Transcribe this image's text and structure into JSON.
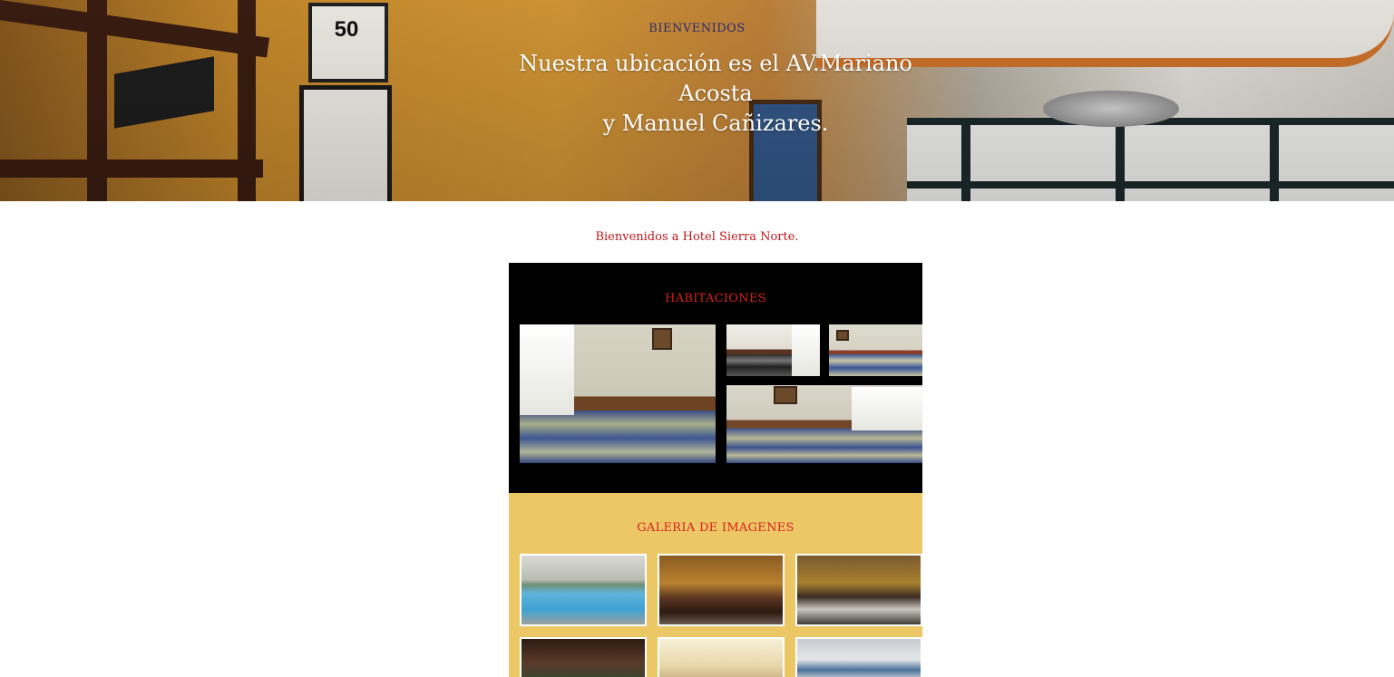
{
  "hero": {
    "eyebrow": "BIENVENIDOS",
    "title_line1": "Nuestra ubicación es el AV.Mariano Acosta",
    "title_line2": "y Manuel Cañizares.",
    "sign_number": "50"
  },
  "welcome": {
    "text": "Bienvenidos a Hotel Sierra Norte."
  },
  "rooms": {
    "heading": "HABITACIONES",
    "background": "#000000",
    "heading_color": "#d8211f"
  },
  "gallery": {
    "heading": "GALERIA DE IMAGENES",
    "background": "#ecc766"
  },
  "colors": {
    "eyebrow": "#2a2a6e",
    "welcome_text": "#c0161b"
  }
}
